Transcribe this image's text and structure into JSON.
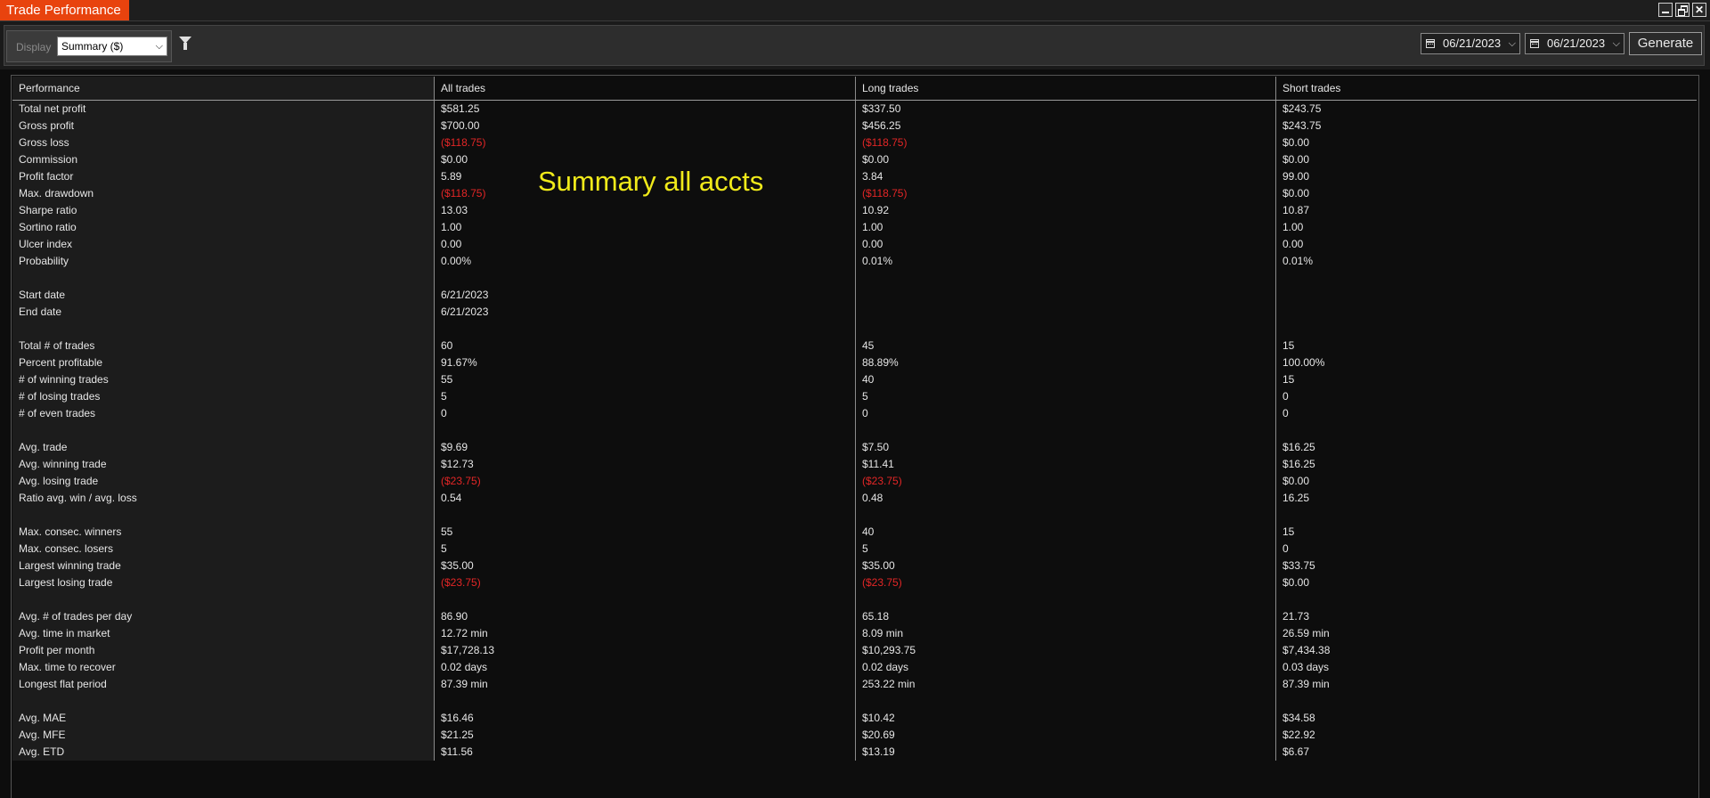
{
  "window": {
    "title": "Trade Performance"
  },
  "toolbar": {
    "display_label": "Display",
    "display_value": "Summary ($)",
    "date_from": "06/21/2023",
    "date_to": "06/21/2023",
    "generate_label": "Generate"
  },
  "columns": [
    "Performance",
    "All trades",
    "Long trades",
    "Short trades"
  ],
  "overlay_text": "Summary all accts",
  "colors": {
    "accent": "#e8430e",
    "negative": "#e32626",
    "overlay": "#f0ea1a"
  },
  "rows": [
    {
      "label": "Total net profit",
      "values": [
        "$581.25",
        "$337.50",
        "$243.75"
      ]
    },
    {
      "label": "Gross profit",
      "values": [
        "$700.00",
        "$456.25",
        "$243.75"
      ]
    },
    {
      "label": "Gross loss",
      "values": [
        "($118.75)",
        "($118.75)",
        "$0.00"
      ]
    },
    {
      "label": "Commission",
      "values": [
        "$0.00",
        "$0.00",
        "$0.00"
      ]
    },
    {
      "label": "Profit factor",
      "values": [
        "5.89",
        "3.84",
        "99.00"
      ]
    },
    {
      "label": "Max. drawdown",
      "values": [
        "($118.75)",
        "($118.75)",
        "$0.00"
      ]
    },
    {
      "label": "Sharpe ratio",
      "values": [
        "13.03",
        "10.92",
        "10.87"
      ]
    },
    {
      "label": "Sortino ratio",
      "values": [
        "1.00",
        "1.00",
        "1.00"
      ]
    },
    {
      "label": "Ulcer index",
      "values": [
        "0.00",
        "0.00",
        "0.00"
      ]
    },
    {
      "label": "Probability",
      "values": [
        "0.00%",
        "0.01%",
        "0.01%"
      ]
    },
    {
      "label": "",
      "values": [
        "",
        "",
        ""
      ]
    },
    {
      "label": "Start date",
      "values": [
        "6/21/2023",
        "",
        ""
      ]
    },
    {
      "label": "End date",
      "values": [
        "6/21/2023",
        "",
        ""
      ]
    },
    {
      "label": "",
      "values": [
        "",
        "",
        ""
      ]
    },
    {
      "label": "Total # of trades",
      "values": [
        "60",
        "45",
        "15"
      ]
    },
    {
      "label": "Percent profitable",
      "values": [
        "91.67%",
        "88.89%",
        "100.00%"
      ]
    },
    {
      "label": "# of winning trades",
      "values": [
        "55",
        "40",
        "15"
      ]
    },
    {
      "label": "# of losing trades",
      "values": [
        "5",
        "5",
        "0"
      ]
    },
    {
      "label": "# of even trades",
      "values": [
        "0",
        "0",
        "0"
      ]
    },
    {
      "label": "",
      "values": [
        "",
        "",
        ""
      ]
    },
    {
      "label": "Avg. trade",
      "values": [
        "$9.69",
        "$7.50",
        "$16.25"
      ]
    },
    {
      "label": "Avg. winning trade",
      "values": [
        "$12.73",
        "$11.41",
        "$16.25"
      ]
    },
    {
      "label": "Avg. losing trade",
      "values": [
        "($23.75)",
        "($23.75)",
        "$0.00"
      ]
    },
    {
      "label": "Ratio avg. win / avg. loss",
      "values": [
        "0.54",
        "0.48",
        "16.25"
      ]
    },
    {
      "label": "",
      "values": [
        "",
        "",
        ""
      ]
    },
    {
      "label": "Max. consec. winners",
      "values": [
        "55",
        "40",
        "15"
      ]
    },
    {
      "label": "Max. consec. losers",
      "values": [
        "5",
        "5",
        "0"
      ]
    },
    {
      "label": "Largest winning trade",
      "values": [
        "$35.00",
        "$35.00",
        "$33.75"
      ]
    },
    {
      "label": "Largest losing trade",
      "values": [
        "($23.75)",
        "($23.75)",
        "$0.00"
      ]
    },
    {
      "label": "",
      "values": [
        "",
        "",
        ""
      ]
    },
    {
      "label": "Avg. # of trades per day",
      "values": [
        "86.90",
        "65.18",
        "21.73"
      ]
    },
    {
      "label": "Avg. time in market",
      "values": [
        "12.72 min",
        "8.09 min",
        "26.59 min"
      ]
    },
    {
      "label": "Profit per month",
      "values": [
        "$17,728.13",
        "$10,293.75",
        "$7,434.38"
      ]
    },
    {
      "label": "Max. time to recover",
      "values": [
        "0.02 days",
        "0.02 days",
        "0.03 days"
      ]
    },
    {
      "label": "Longest flat period",
      "values": [
        "87.39 min",
        "253.22 min",
        "87.39 min"
      ]
    },
    {
      "label": "",
      "values": [
        "",
        "",
        ""
      ]
    },
    {
      "label": "Avg. MAE",
      "values": [
        "$16.46",
        "$10.42",
        "$34.58"
      ]
    },
    {
      "label": "Avg. MFE",
      "values": [
        "$21.25",
        "$20.69",
        "$22.92"
      ]
    },
    {
      "label": "Avg. ETD",
      "values": [
        "$11.56",
        "$13.19",
        "$6.67"
      ]
    }
  ]
}
